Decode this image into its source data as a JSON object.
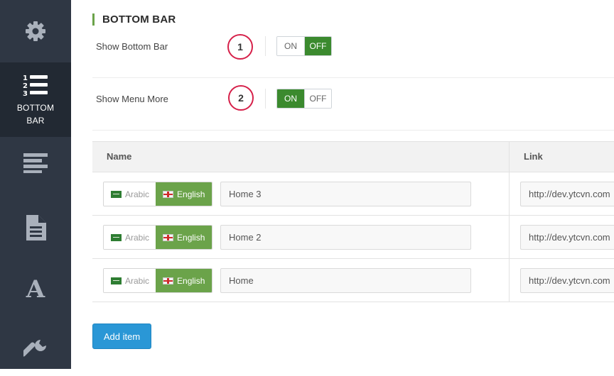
{
  "sidebar": {
    "items": [
      {
        "icon": "gear-icon"
      },
      {
        "icon": "numbered-list-icon",
        "label": "BOTTOM BAR",
        "active": true
      },
      {
        "icon": "align-left-icon"
      },
      {
        "icon": "document-icon"
      },
      {
        "icon": "font-icon",
        "glyph": "A"
      },
      {
        "icon": "wrench-icon"
      }
    ]
  },
  "section": {
    "title": "BOTTOM BAR"
  },
  "options": [
    {
      "label": "Show Bottom Bar",
      "badge": "1",
      "on_label": "ON",
      "off_label": "OFF",
      "value": "OFF"
    },
    {
      "label": "Show Menu More",
      "badge": "2",
      "on_label": "ON",
      "off_label": "OFF",
      "value": "ON"
    }
  ],
  "table": {
    "headers": {
      "name": "Name",
      "link": "Link"
    },
    "languages": {
      "arabic": "Arabic",
      "english": "English"
    },
    "rows": [
      {
        "name": "Home 3",
        "link": "http://dev.ytcvn.com"
      },
      {
        "name": "Home 2",
        "link": "http://dev.ytcvn.com"
      },
      {
        "name": "Home",
        "link": "http://dev.ytcvn.com"
      }
    ]
  },
  "add_button": {
    "label": "Add item"
  },
  "colors": {
    "accent_green": "#3b8a2e",
    "lang_green": "#6ba34a",
    "badge_red": "#d6214a",
    "button_blue": "#2a97d6",
    "sidebar": "#2f3744"
  }
}
